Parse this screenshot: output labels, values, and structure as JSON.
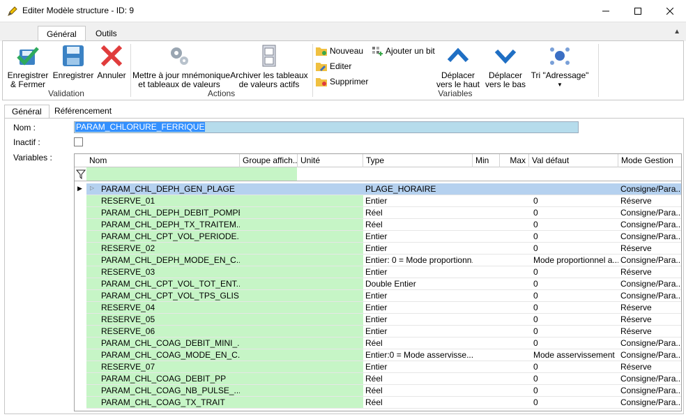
{
  "window": {
    "title": "Editer Modèle structure - ID: 9"
  },
  "ribbon_tabs": [
    "Général",
    "Outils"
  ],
  "ribbon": {
    "validation": {
      "label": "Validation",
      "save_close": [
        "Enregistrer",
        "& Fermer"
      ],
      "save": "Enregistrer",
      "cancel": "Annuler"
    },
    "actions": {
      "label": "Actions",
      "update": [
        "Mettre à jour mnémonique",
        "et tableaux de valeurs"
      ],
      "archive": [
        "Archiver les tableaux",
        "de valeurs actifs"
      ]
    },
    "variables": {
      "label": "Variables",
      "new": "Nouveau",
      "edit": "Editer",
      "delete": "Supprimer",
      "add_bit": "Ajouter un bit",
      "move_up": [
        "Déplacer",
        "vers le haut"
      ],
      "move_down": [
        "Déplacer",
        "vers le bas"
      ],
      "sort": "Tri \"Adressage\""
    }
  },
  "sub_tabs": [
    "Général",
    "Référencement"
  ],
  "form": {
    "name_label": "Nom :",
    "name_value": "PARAM_CHLORURE_FERRIQUE",
    "inactive_label": "Inactif :",
    "variables_label": "Variables :"
  },
  "grid": {
    "columns": [
      "Nom",
      "Groupe affich...",
      "Unité",
      "Type",
      "Min",
      "Max",
      "Val défaut",
      "Mode Gestion"
    ],
    "rows": [
      [
        "PARAM_CHL_DEPH_GEN_PLAGE",
        "",
        "",
        "PLAGE_HORAIRE",
        "",
        "",
        "",
        "Consigne/Para..."
      ],
      [
        "RESERVE_01",
        "",
        "",
        "Entier",
        "",
        "",
        "0",
        "Réserve"
      ],
      [
        "PARAM_CHL_DEPH_DEBIT_POMPE",
        "",
        "",
        "Réel",
        "",
        "",
        "0",
        "Consigne/Para..."
      ],
      [
        "PARAM_CHL_DEPH_TX_TRAITEM...",
        "",
        "",
        "Réel",
        "",
        "",
        "0",
        "Consigne/Para..."
      ],
      [
        "PARAM_CHL_CPT_VOL_PERIODE...",
        "",
        "",
        "Entier",
        "",
        "",
        "0",
        "Consigne/Para..."
      ],
      [
        "RESERVE_02",
        "",
        "",
        "Entier",
        "",
        "",
        "0",
        "Réserve"
      ],
      [
        "PARAM_CHL_DEPH_MODE_EN_C...",
        "",
        "",
        "Entier: 0 = Mode proportionn...",
        "",
        "",
        "Mode proportionnel a...",
        "Consigne/Para..."
      ],
      [
        "RESERVE_03",
        "",
        "",
        "Entier",
        "",
        "",
        "0",
        "Réserve"
      ],
      [
        "PARAM_CHL_CPT_VOL_TOT_ENT...",
        "",
        "",
        "Double Entier",
        "",
        "",
        "0",
        "Consigne/Para..."
      ],
      [
        "PARAM_CHL_CPT_VOL_TPS_GLIS...",
        "",
        "",
        "Entier",
        "",
        "",
        "0",
        "Consigne/Para..."
      ],
      [
        "RESERVE_04",
        "",
        "",
        "Entier",
        "",
        "",
        "0",
        "Réserve"
      ],
      [
        "RESERVE_05",
        "",
        "",
        "Entier",
        "",
        "",
        "0",
        "Réserve"
      ],
      [
        "RESERVE_06",
        "",
        "",
        "Entier",
        "",
        "",
        "0",
        "Réserve"
      ],
      [
        "PARAM_CHL_COAG_DEBIT_MINI_...",
        "",
        "",
        "Réel",
        "",
        "",
        "0",
        "Consigne/Para..."
      ],
      [
        "PARAM_CHL_COAG_MODE_EN_C...",
        "",
        "",
        "Entier:0 = Mode asservisse...",
        "",
        "",
        "Mode asservissement",
        "Consigne/Para..."
      ],
      [
        "RESERVE_07",
        "",
        "",
        "Entier",
        "",
        "",
        "0",
        "Réserve"
      ],
      [
        "PARAM_CHL_COAG_DEBIT_PP",
        "",
        "",
        "Réel",
        "",
        "",
        "0",
        "Consigne/Para..."
      ],
      [
        "PARAM_CHL_COAG_NB_PULSE_...",
        "",
        "",
        "Réel",
        "",
        "",
        "0",
        "Consigne/Para..."
      ],
      [
        "PARAM_CHL_COAG_TX_TRAIT",
        "",
        "",
        "Réel",
        "",
        "",
        "0",
        "Consigne/Para..."
      ]
    ]
  },
  "colors": {
    "editable_green": "#c6f5c6",
    "selection": "#b5d1ef",
    "name_field": "#b6dcec"
  }
}
